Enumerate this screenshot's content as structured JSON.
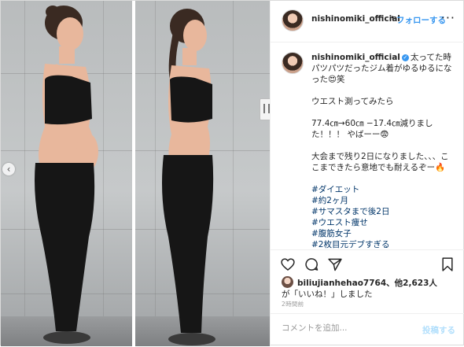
{
  "header": {
    "username": "nishinomiki_official",
    "dot": "•",
    "follow_label": "フォローする",
    "more_icon": "more-icon"
  },
  "caption": {
    "username": "nishinomiki_official",
    "text_1": "太ってた時パツパツだったジム着がゆるゆるになった😍笑",
    "text_2": "ウエスト測ってみたら",
    "text_3": "77.4㎝→60㎝ −17.4㎝減りました！！！ やばーー😨",
    "text_4": "大会まで残り2日になりました、、、ここまできたら意地でも耐えるぞー🔥",
    "hashtags": [
      "#ダイエット",
      "#約2ヶ月",
      "#サマスタまで後2日",
      "#ウエスト痩せ",
      "#腹筋女子",
      "#2枚目元デブすぎる"
    ]
  },
  "actions": {
    "like_icon": "heart-icon",
    "comment_icon": "comment-icon",
    "share_icon": "share-icon",
    "save_icon": "bookmark-icon"
  },
  "likes": {
    "user": "biliujianhehao7764",
    "count_text": "、他2,623人",
    "line2": "が「いいね！」しました"
  },
  "timestamp": "2時間前",
  "comment": {
    "placeholder": "コメントを追加...",
    "post_label": "投稿する"
  },
  "colors": {
    "accent": "#3897f0",
    "hashtag": "#003569",
    "post_disabled": "#b2dffc"
  }
}
